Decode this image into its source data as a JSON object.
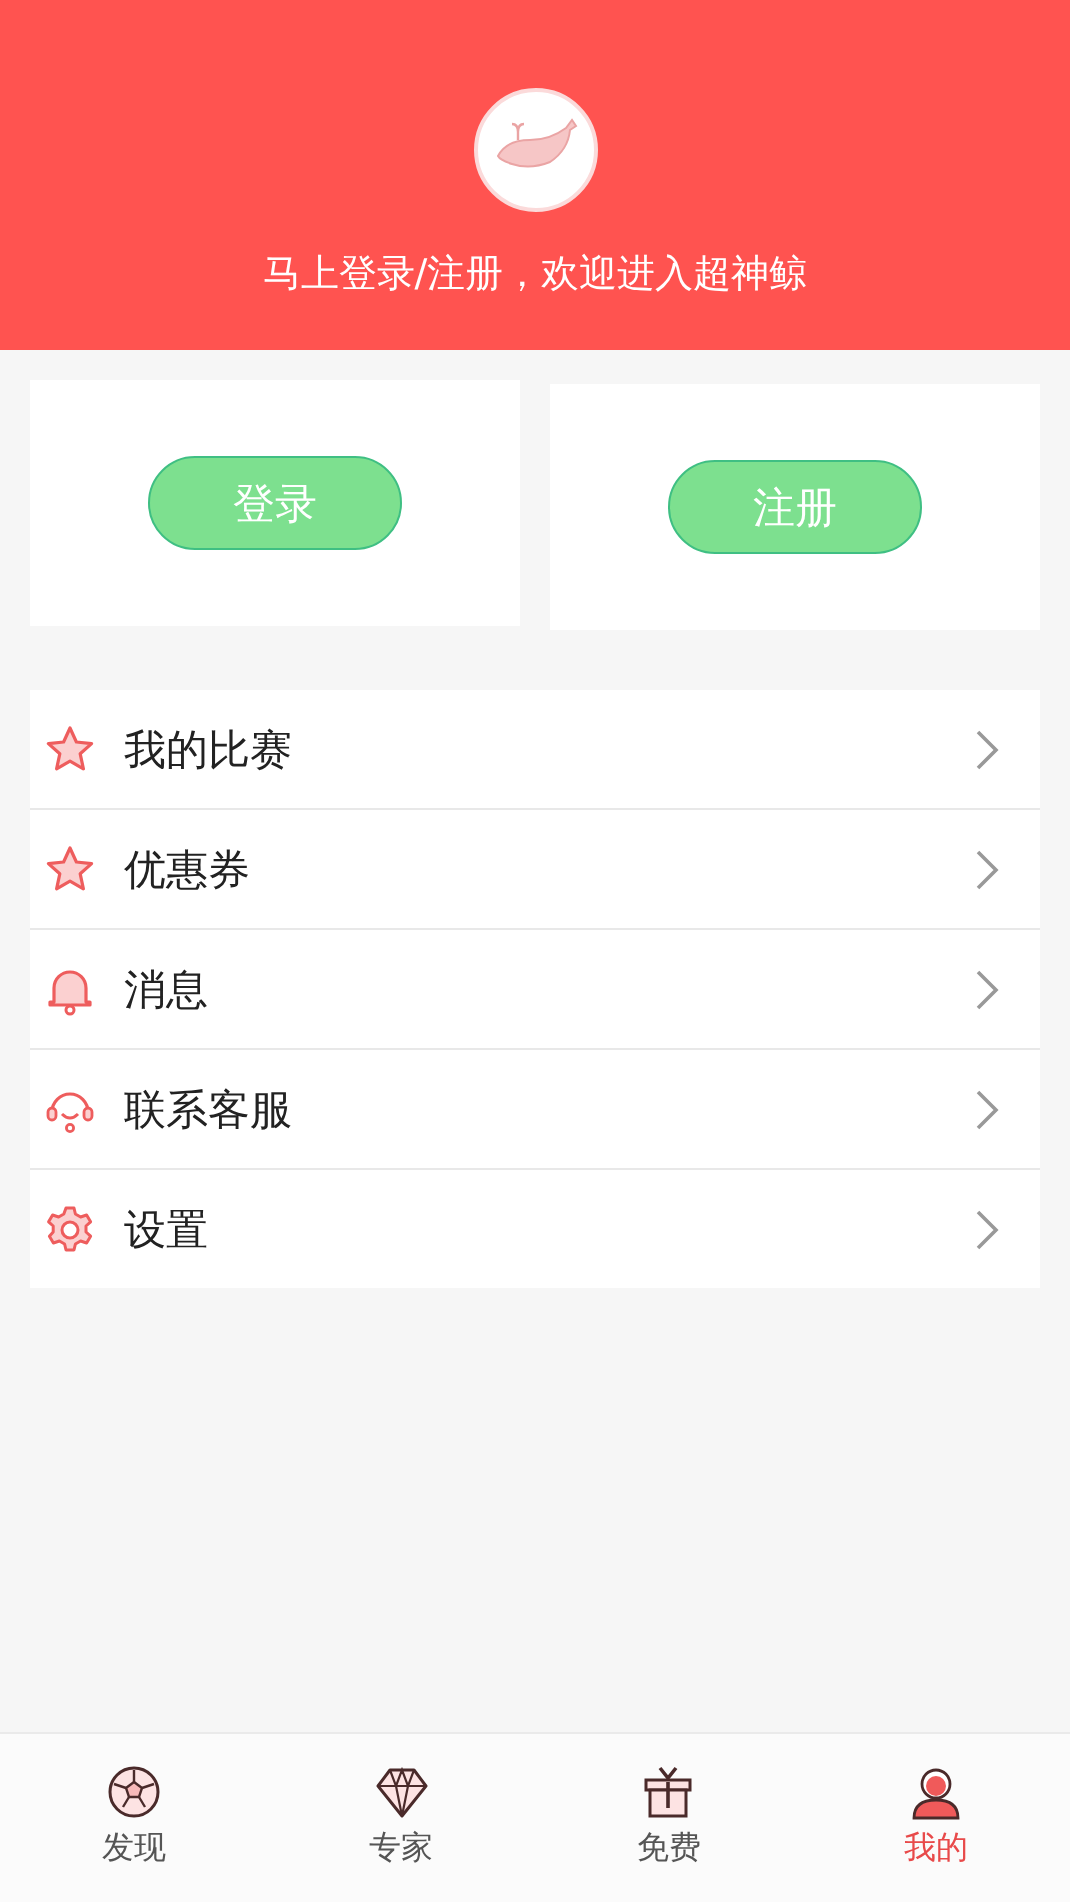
{
  "header": {
    "greeting": "马上登录/注册，欢迎进入超神鲸"
  },
  "auth_buttons": [
    "登录",
    "注册"
  ],
  "menu": [
    {
      "kind": "star",
      "label": "我的比赛"
    },
    {
      "kind": "star",
      "label": "优惠券"
    },
    {
      "kind": "bell",
      "label": "消息"
    },
    {
      "kind": "headset",
      "label": "联系客服"
    },
    {
      "kind": "gear",
      "label": "设置"
    }
  ],
  "tab_bar": [
    {
      "kind": "ball",
      "label": "发现",
      "selected": false
    },
    {
      "kind": "diamond",
      "label": "专家",
      "selected": false
    },
    {
      "kind": "gift",
      "label": "免费",
      "selected": false
    },
    {
      "kind": "person",
      "label": "我的",
      "selected": true
    }
  ]
}
